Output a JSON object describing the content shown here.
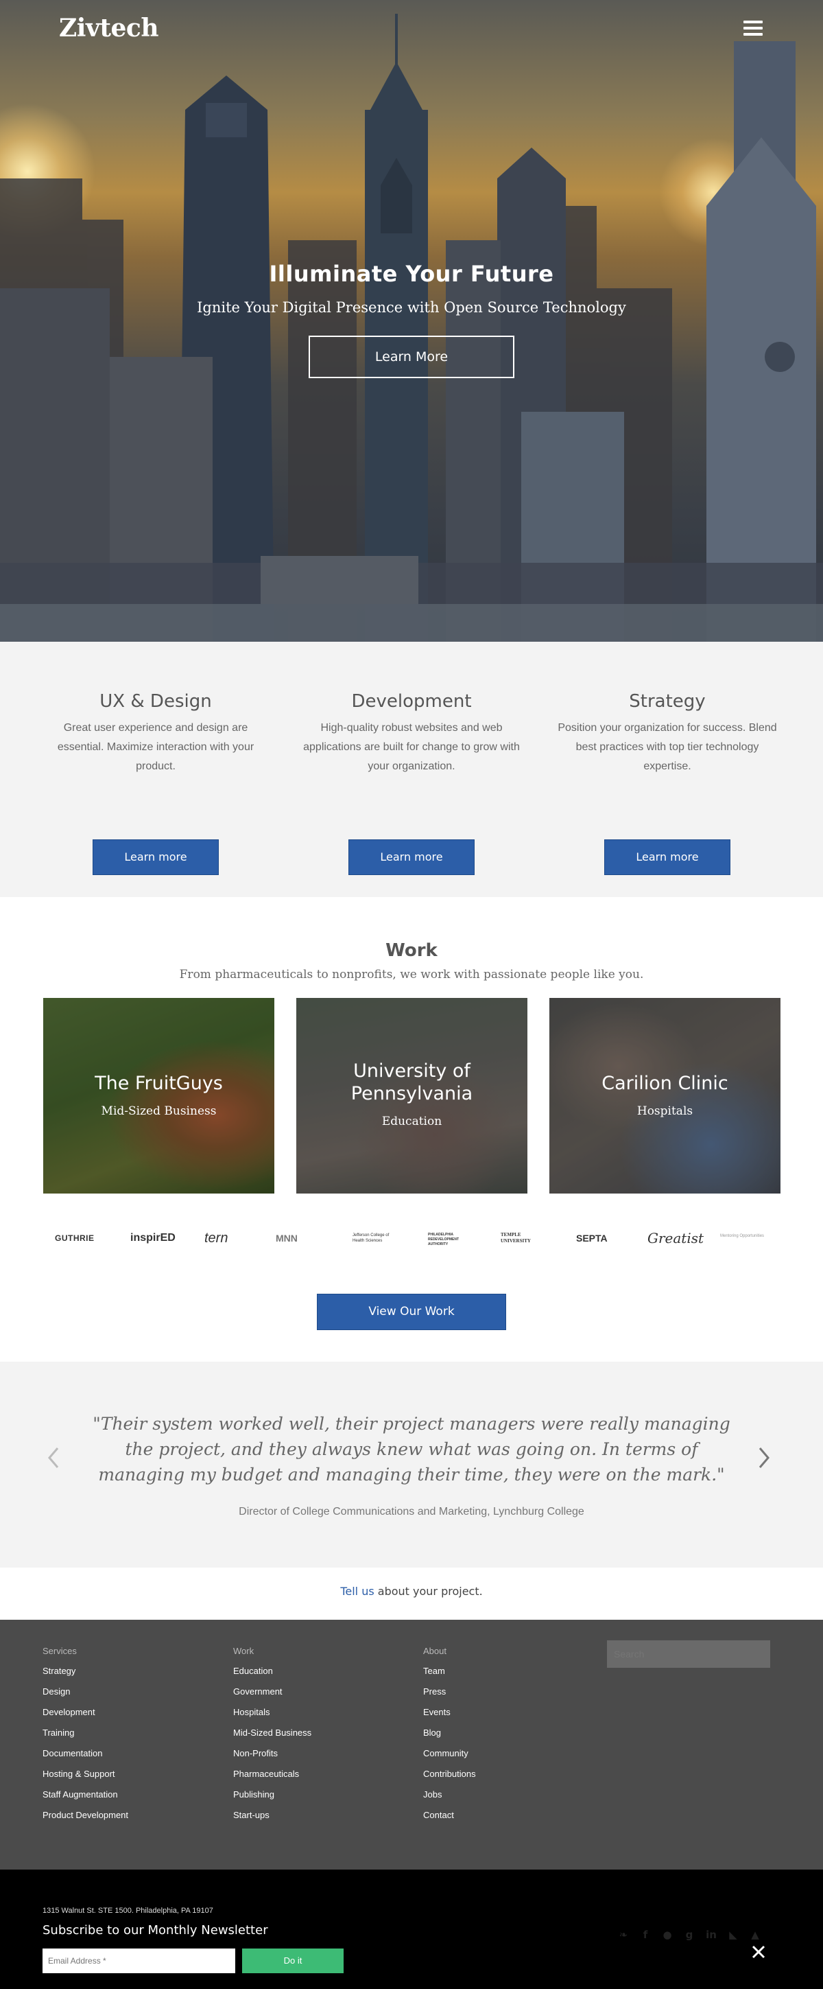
{
  "header": {
    "logo": "Zivtech",
    "menu_icon": "hamburger-icon"
  },
  "hero": {
    "title": "Illuminate Your Future",
    "subtitle": "Ignite Your Digital Presence with Open Source Technology",
    "cta": "Learn More"
  },
  "services": [
    {
      "title": "UX & Design",
      "text": "Great user experience and design are essential. Maximize interaction with your product.",
      "cta": "Learn more"
    },
    {
      "title": "Development",
      "text": "High-quality robust websites and web applications are built for change to grow with your organization.",
      "cta": "Learn more"
    },
    {
      "title": "Strategy",
      "text": "Position your organization for success. Blend best practices with top tier technology expertise.",
      "cta": "Learn more"
    }
  ],
  "work": {
    "title": "Work",
    "subtitle": "From pharmaceuticals to nonprofits, we work with passionate people like you.",
    "cards": [
      {
        "name": "The FruitGuys",
        "category": "Mid-Sized Business"
      },
      {
        "name": "University of Pennsylvania",
        "category": "Education"
      },
      {
        "name": "Carilion Clinic",
        "category": "Hospitals"
      }
    ],
    "clients": [
      "GUTHRIE",
      "inspirED",
      "tern",
      "MNN",
      "Jefferson College of Health Sciences",
      "PHILADELPHIA REDEVELOPMENT AUTHORITY",
      "TEMPLE UNIVERSITY",
      "SEPTA",
      "Greatist",
      "Mentoring Opportunities"
    ],
    "cta": "View Our Work"
  },
  "testimonial": {
    "quote": "\"Their system worked well, their project managers were really managing the project, and they always knew what was going on. In terms of managing my budget and managing their time, they were on the mark.\"",
    "attribution": "Director of College Communications and Marketing, Lynchburg College"
  },
  "tellus": {
    "link": "Tell us",
    "rest": " about your project."
  },
  "footer": {
    "columns": [
      {
        "heading": "Services",
        "links": [
          "Strategy",
          "Design",
          "Development",
          "Training",
          "Documentation",
          "Hosting & Support",
          "Staff Augmentation",
          "Product Development"
        ]
      },
      {
        "heading": "Work",
        "links": [
          "Education",
          "Government",
          "Hospitals",
          "Mid-Sized Business",
          "Non-Profits",
          "Pharmaceuticals",
          "Publishing",
          "Start-ups"
        ]
      },
      {
        "heading": "About",
        "links": [
          "Team",
          "Press",
          "Events",
          "Blog",
          "Community",
          "Contributions",
          "Jobs",
          "Contact"
        ]
      }
    ],
    "search_placeholder": "Search"
  },
  "newsletter": {
    "address": "1315 Walnut St. STE 1500. Philadelphia, PA 19107",
    "title": "Subscribe to our Monthly Newsletter",
    "email_placeholder": "Email Address *",
    "submit": "Do it",
    "socials": [
      "twitter-icon",
      "facebook-icon",
      "github-icon",
      "google-plus-icon",
      "linkedin-icon",
      "rss-icon",
      "drupal-icon"
    ]
  },
  "colors": {
    "accent_blue": "#2c5ea8",
    "green": "#3dbb75",
    "footer_gray": "#4b4b4b",
    "section_gray": "#f3f3f3"
  }
}
